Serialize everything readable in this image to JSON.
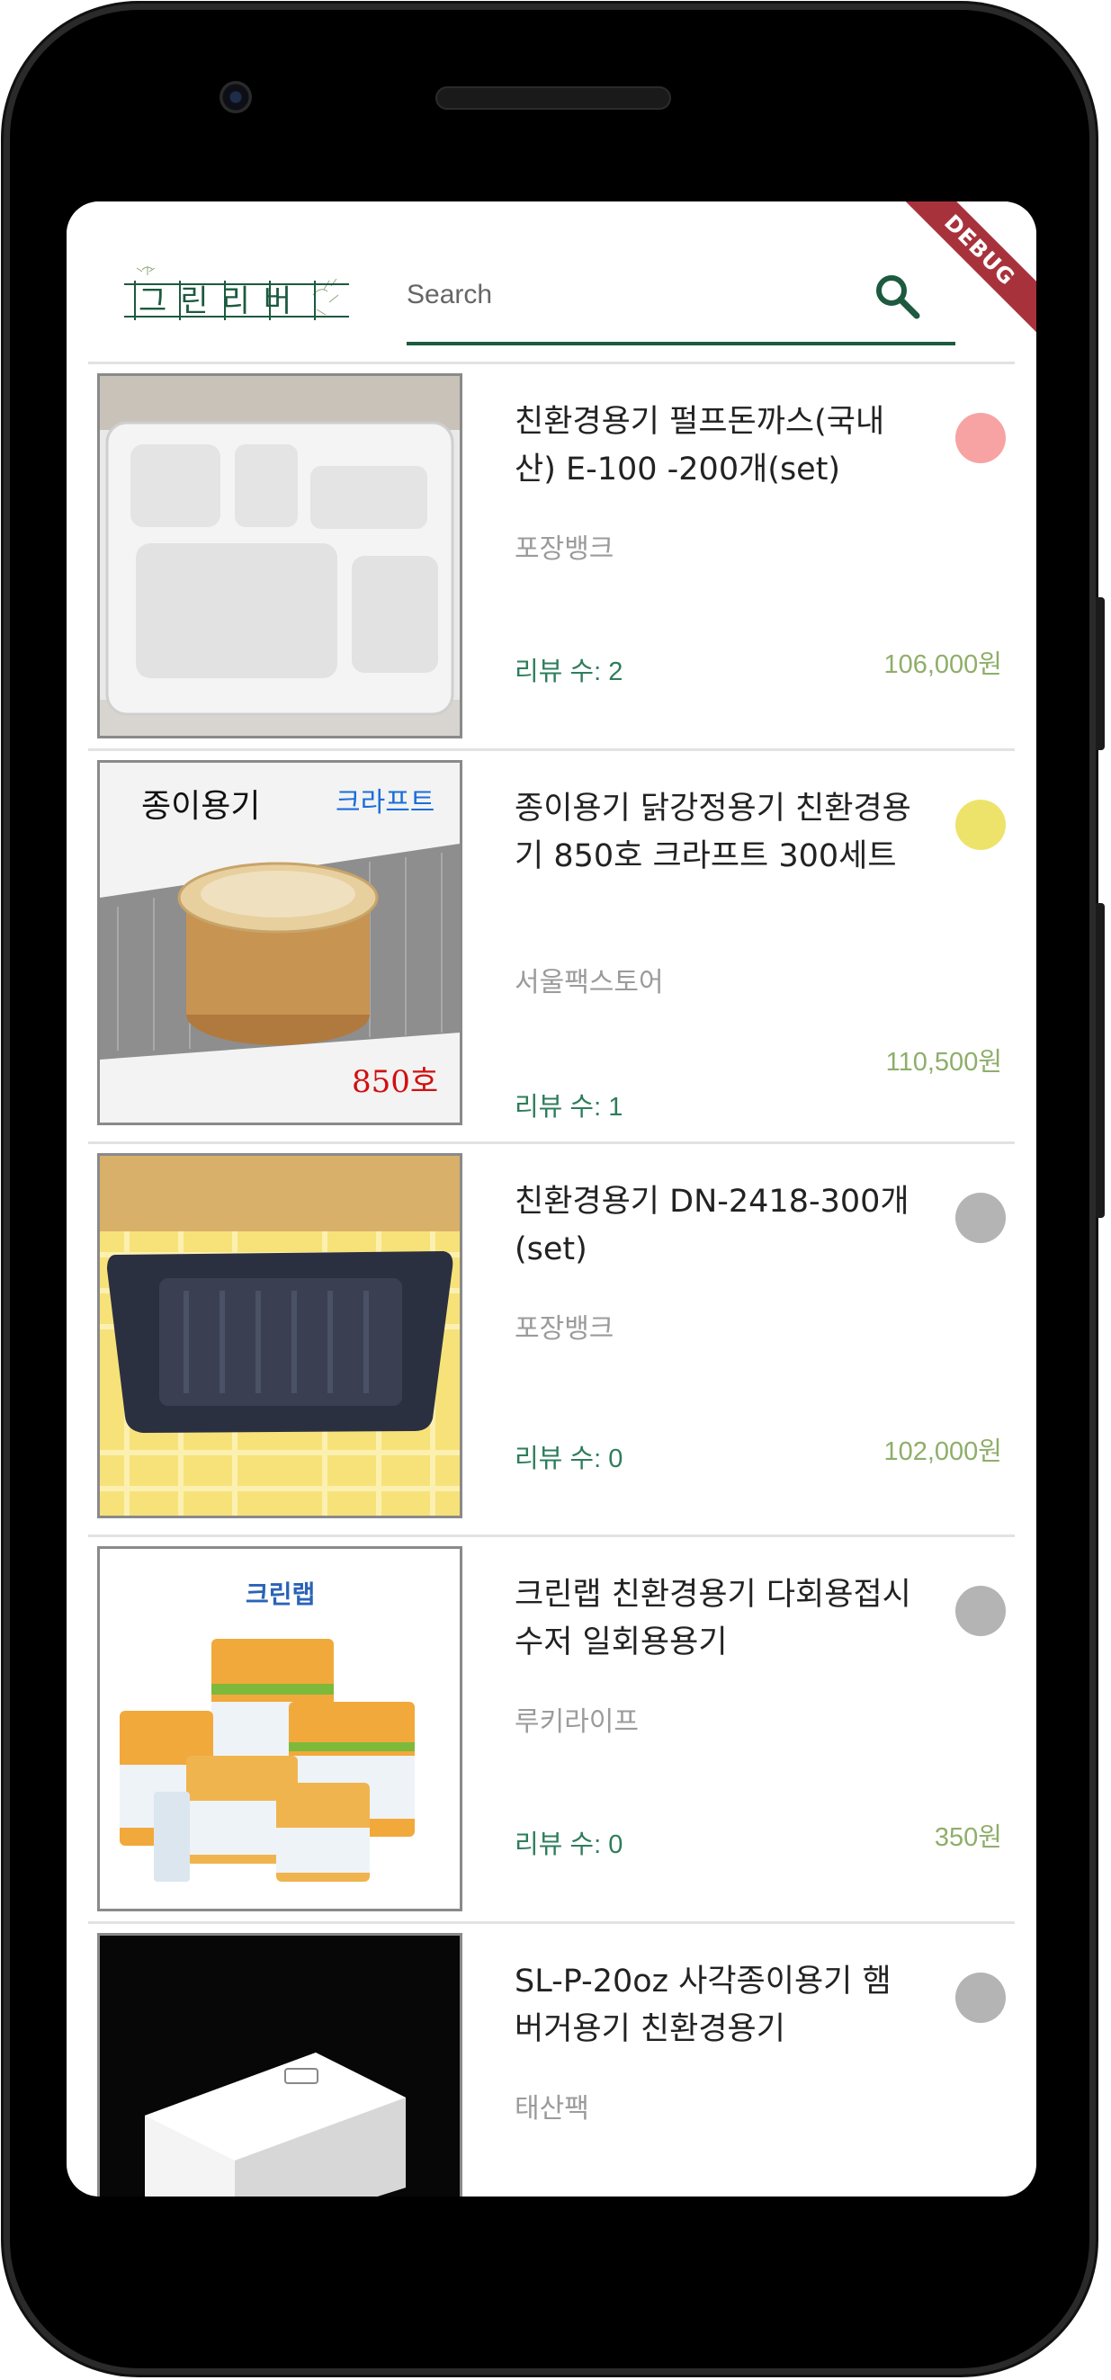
{
  "app": {
    "logo_text": "그린리버",
    "search_placeholder": "Search",
    "debug_banner": "DEBUG"
  },
  "products": [
    {
      "title": "친환경용기 펄프돈까스(국내산) E-100 -200개(set)",
      "seller": "포장뱅크",
      "reviews": "리뷰 수: 2",
      "price": "106,000원",
      "status_color": "#f7a3a3"
    },
    {
      "title": "종이용기 닭강정용기 친환경용기 850호 크라프트 300세트",
      "seller": "서울팩스토어",
      "reviews": "리뷰 수: 1",
      "price": "110,500원",
      "status_color": "#ede36a",
      "image_labels": {
        "left": "종이용기",
        "right": "크라프트",
        "size": "850호"
      }
    },
    {
      "title": "친환경용기 DN-2418-300개(set)",
      "seller": "포장뱅크",
      "reviews": "리뷰 수: 0",
      "price": "102,000원",
      "status_color": "#b4b4b4"
    },
    {
      "title": "크린랩 친환경용기 다회용접시 수저 일회용용기",
      "seller": "루키라이프",
      "reviews": "리뷰 수: 0",
      "price": "350원",
      "status_color": "#b4b4b4",
      "image_labels": {
        "brand": "크린랩"
      }
    },
    {
      "title": "SL-P-20oz 사각종이용기 햄버거용기 친환경용기",
      "seller": "태산팩",
      "reviews": "",
      "price": "",
      "status_color": "#b4b4b4"
    }
  ]
}
